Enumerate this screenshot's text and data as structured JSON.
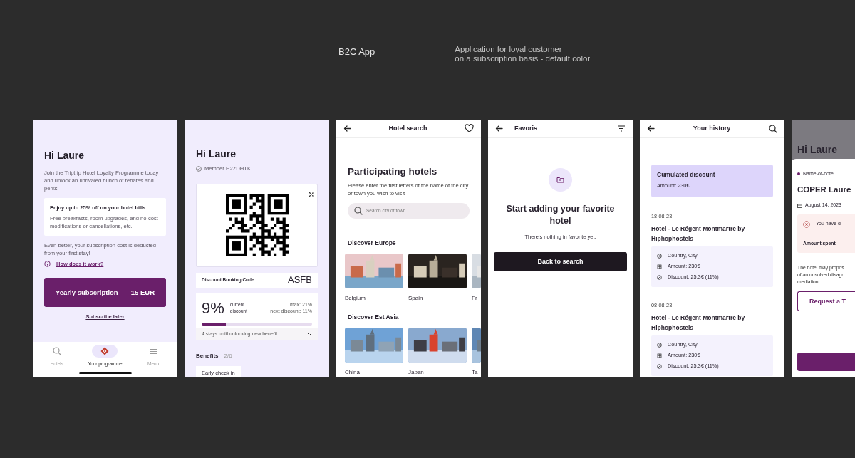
{
  "header": {
    "title": "B2C App",
    "description_lines": [
      "Application for loyal customer",
      "on a subscription basis - default color"
    ]
  },
  "screens": [
    {
      "kind": "onboarding",
      "greeting": "Hi Laure",
      "intro": "Join the Triptrip Hotel Loyalty Programme today and unlock an unrivaled bunch of rebates and perks.",
      "benefit_card": {
        "title": "Enjoy up to 25% off on your hotel bills",
        "text": "Free breakfasts, room upgrades, and no-cost modifications or cancellations, etc."
      },
      "note": "Even better, your subscription cost is deducted from your first stay!",
      "help_link": "How does  it work?",
      "cta": {
        "label": "Yearly subscription",
        "price": "15 EUR"
      },
      "secondary_link": "Subscribe later",
      "tabs": [
        {
          "kind": "search",
          "label": "Hotels",
          "selected": false
        },
        {
          "kind": "logo",
          "label": "Your programme",
          "selected": true
        },
        {
          "kind": "menu",
          "label": "Menu",
          "selected": false
        }
      ]
    },
    {
      "kind": "programme",
      "greeting": "Hi Laure",
      "member": "Member H2ZDHTK",
      "booking_code": {
        "label": "Discount Booking Code",
        "value": "ASFB"
      },
      "discount": {
        "value": "9%",
        "label": "current discount",
        "max": "max: 21%",
        "next": "next discount: 11%",
        "level": 0.22
      },
      "progress_note": "4 stays until unlocking new benefit",
      "benefits": {
        "title": "Benefits",
        "count": "2/6",
        "items": [
          "Early check in"
        ]
      }
    },
    {
      "kind": "search",
      "nav_title": "Hotel search",
      "heading": "Participating hotels",
      "instructions": "Please enter the first letters of the name  of the city or town you wish to visit",
      "search": {
        "placeholder": "Search city or town"
      },
      "sections": [
        {
          "title": "Discover Europe",
          "destinations": [
            "Belgium",
            "Spain",
            "Fr"
          ]
        },
        {
          "title": "Discover Est Asia",
          "destinations": [
            "China",
            "Japan",
            "Ta"
          ]
        }
      ]
    },
    {
      "kind": "favorites",
      "nav_title": "Favoris",
      "heading": "Start adding your favorite hotel",
      "text": "There's nothing in favorite yet.",
      "button": "Back to search"
    },
    {
      "kind": "history",
      "nav_title": "Your history",
      "summary": {
        "title": "Cumulated discount",
        "amount": "Amount: 230€"
      },
      "entries": [
        {
          "date": "18-08-23",
          "hotel": "Hotel - Le Régent Montmartre by Hiphophostels",
          "details": [
            {
              "kind": "location",
              "text": "Country, City"
            },
            {
              "kind": "amount",
              "text": "Amount: 230€"
            },
            {
              "kind": "discount",
              "text": "Discount: 25,3€ (11%)"
            }
          ]
        },
        {
          "date": "08-08-23",
          "hotel": "Hotel - Le Régent Montmartre by Hiphophostels",
          "details": [
            {
              "kind": "location",
              "text": "Country, City"
            },
            {
              "kind": "amount",
              "text": "Amount: 230€"
            },
            {
              "kind": "discount",
              "text": "Discount: 25,3€ (11%)"
            }
          ]
        }
      ]
    },
    {
      "kind": "dispute",
      "greeting": "Hi Laure",
      "sheet": {
        "hotel": "Name-of-hotel",
        "guest": "COPER Laure",
        "date": "August 14, 2023",
        "alert": "You have d",
        "amount_label": "Amount spent",
        "paragraph_lines": [
          "The hotel may propos",
          "of an unsolved disagr",
          "mediation"
        ],
        "outline_button": "Request a T"
      }
    }
  ]
}
